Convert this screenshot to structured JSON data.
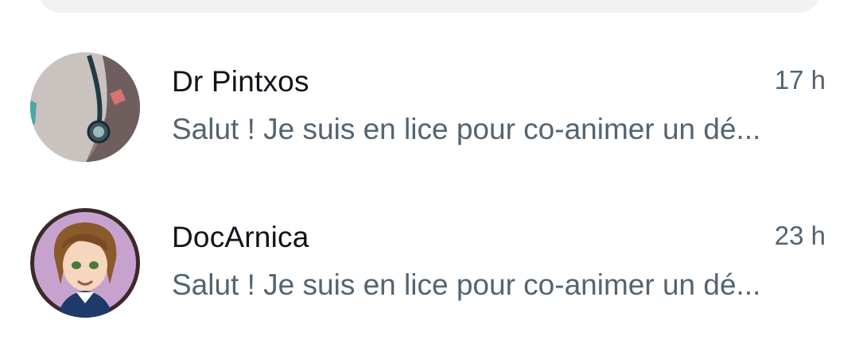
{
  "search": {},
  "conversations": [
    {
      "name": "Dr Pintxos",
      "time": "17 h",
      "preview": "Salut ! Je suis en lice pour co-animer un dé..."
    },
    {
      "name": "DocArnica",
      "time": "23 h",
      "preview": "Salut ! Je suis en lice pour co-animer un dé..."
    }
  ]
}
